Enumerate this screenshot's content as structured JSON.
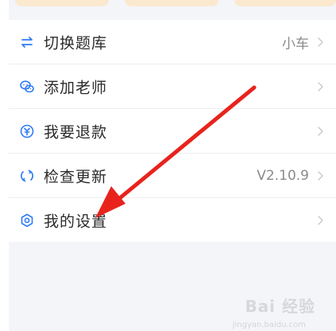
{
  "menu": {
    "items": [
      {
        "label": "切换题库",
        "value": "小车",
        "icon": "switch-icon"
      },
      {
        "label": "添加老师",
        "value": "",
        "icon": "wechat-icon"
      },
      {
        "label": "我要退款",
        "value": "",
        "icon": "refund-icon"
      },
      {
        "label": "检查更新",
        "value": "V2.10.9",
        "icon": "refresh-icon"
      },
      {
        "label": "我的设置",
        "value": "",
        "icon": "gear-icon"
      }
    ]
  },
  "watermark": {
    "text": "Bai 经验",
    "sub": "jingyan.baidu.com"
  },
  "colors": {
    "accent": "#2f7bf5",
    "annotation_arrow": "#e8231c",
    "top_card": "#fbe9cf"
  }
}
